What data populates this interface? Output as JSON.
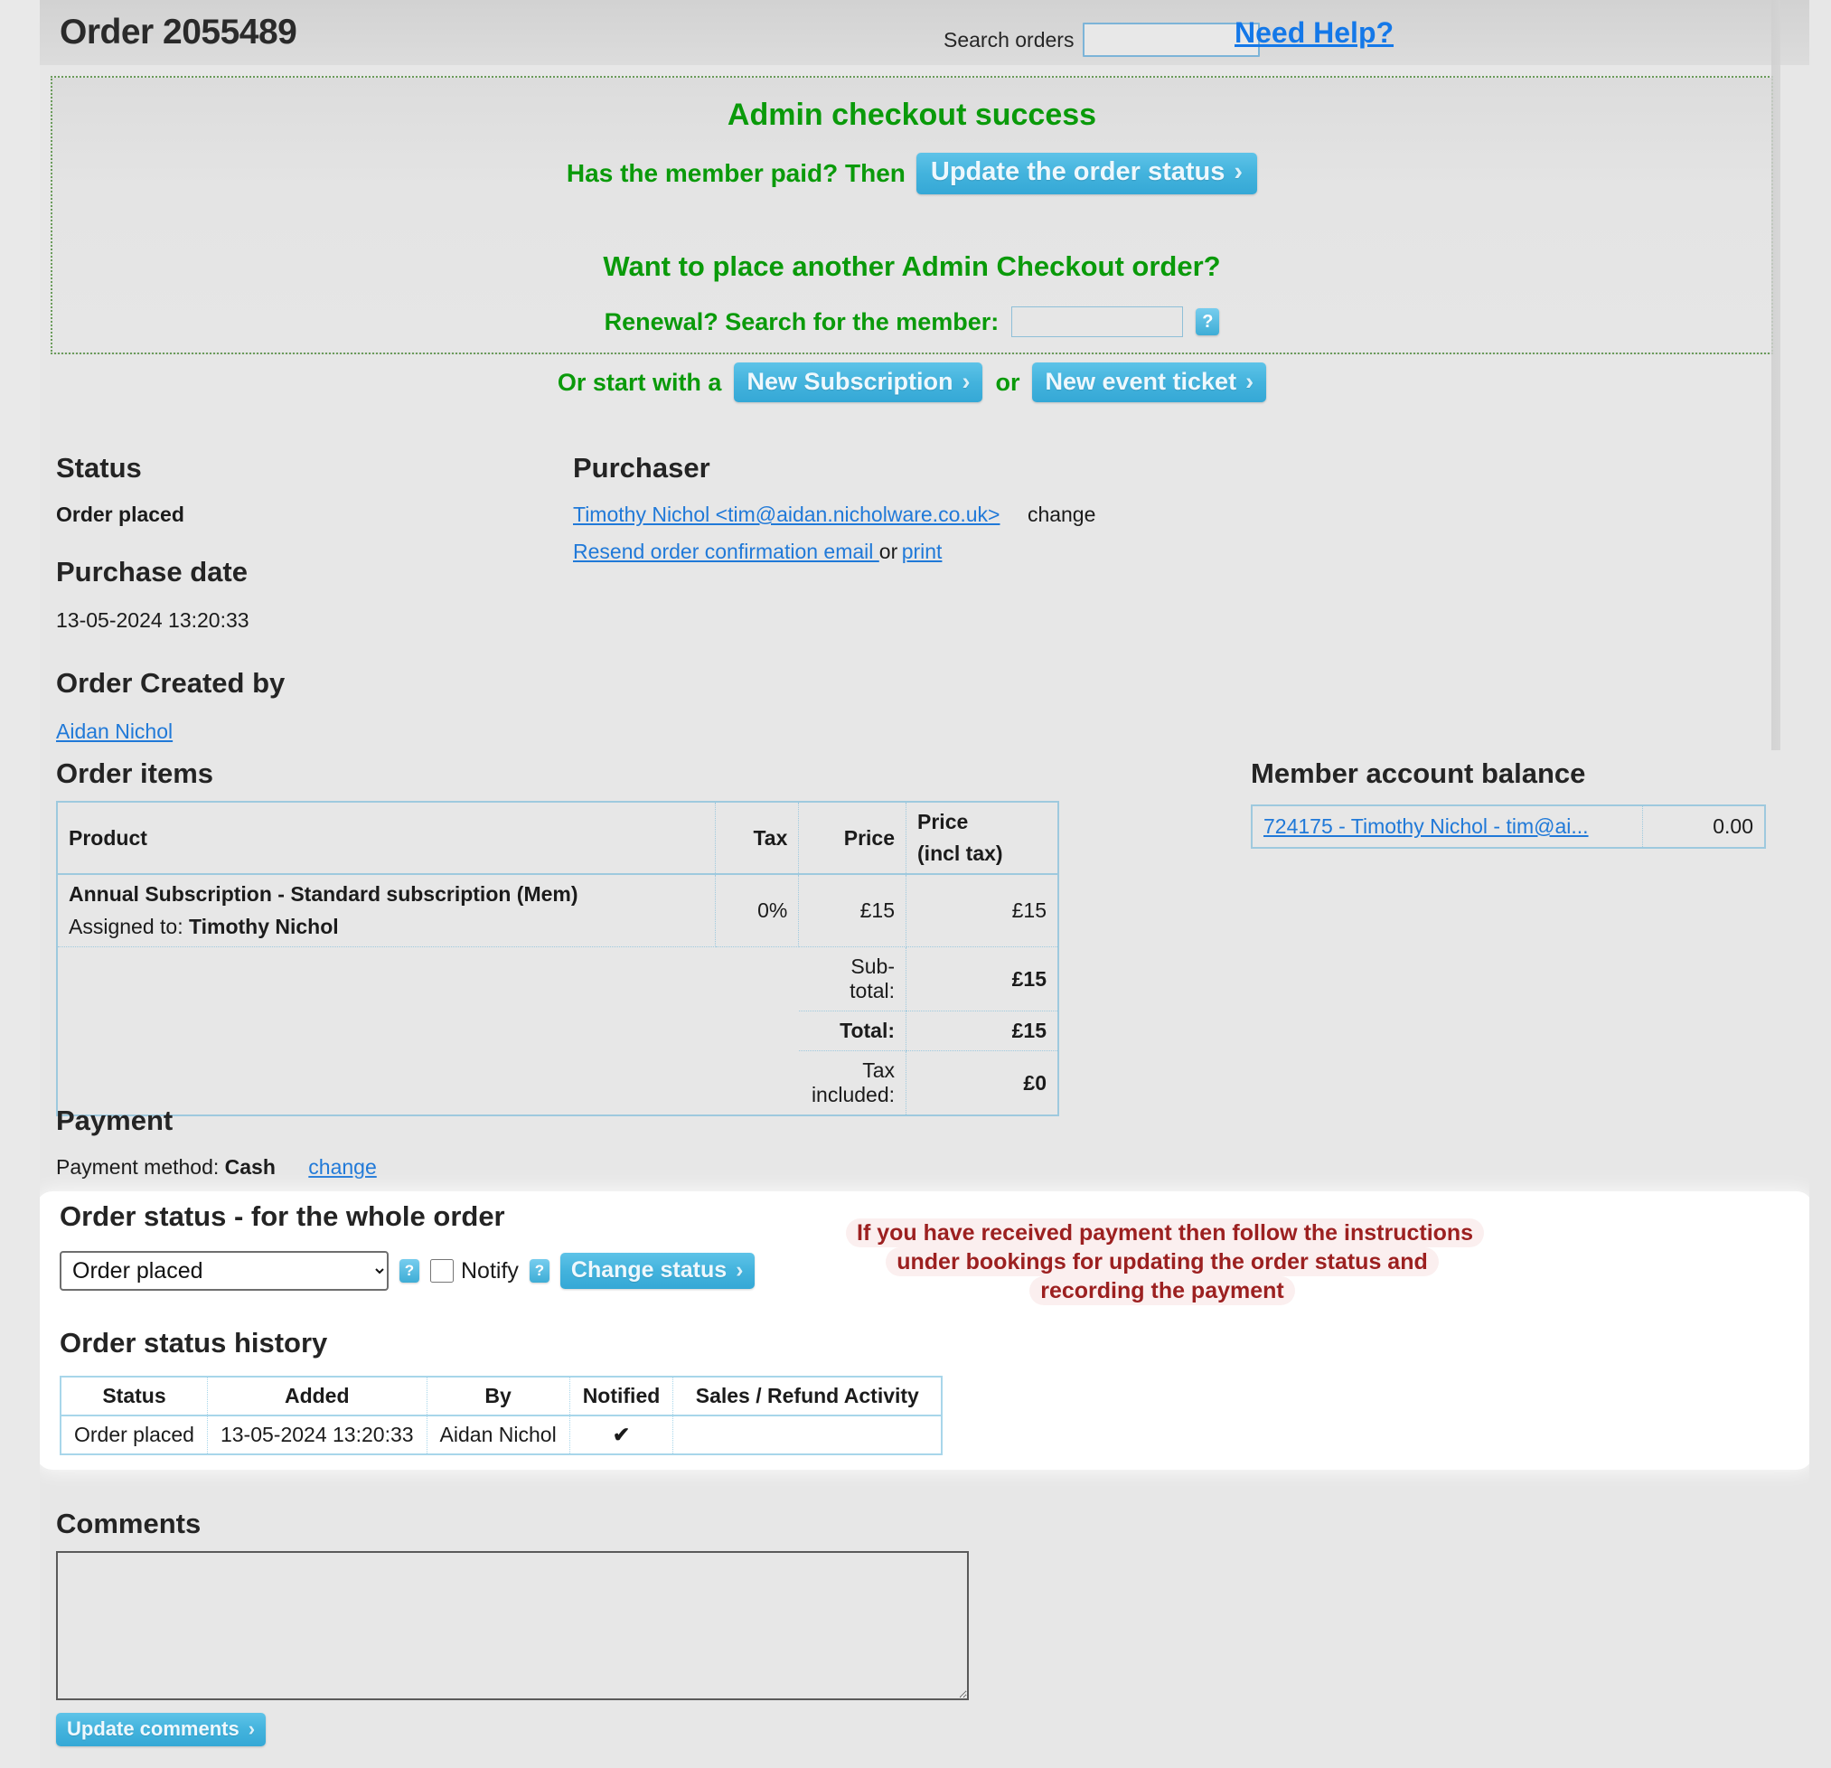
{
  "header": {
    "order_title": "Order 2055489",
    "search_label": "Search orders",
    "search_value": "",
    "search_placeholder": "",
    "need_help": "Need Help?"
  },
  "success_panel": {
    "title": "Admin checkout success",
    "paid_question": "Has the member paid? Then",
    "update_status_button": "Update the order status",
    "another_order_title": "Want to place another Admin Checkout order?",
    "renewal_label": "Renewal? Search for the member:",
    "renewal_value": "",
    "renewal_placeholder": "",
    "help_icon": "?",
    "start_with_label": "Or start with a",
    "new_subscription_button": "New Subscription",
    "or_label": "or",
    "new_event_ticket_button": "New event ticket",
    "chevron": "›"
  },
  "status": {
    "heading": "Status",
    "value": "Order placed",
    "purchase_date_heading": "Purchase date",
    "purchase_date": "13-05-2024 13:20:33",
    "created_by_heading": "Order Created by",
    "created_by": "Aidan Nichol"
  },
  "purchaser": {
    "heading": "Purchaser",
    "name_email": "Timothy Nichol <tim@aidan.nicholware.co.uk>",
    "change": "change",
    "resend_email": "Resend order confirmation email ",
    "or": "or",
    "print": "print"
  },
  "order_items": {
    "heading": "Order items",
    "columns": [
      "Product",
      "Tax",
      "Price",
      "Price",
      "(incl tax)"
    ],
    "col_product": "Product",
    "col_tax": "Tax",
    "col_price": "Price",
    "col_price_incl_1": "Price",
    "col_price_incl_2": "(incl tax)",
    "rows": [
      {
        "product": "Annual Subscription - Standard subscription (Mem)",
        "assigned_label": "Assigned to: ",
        "assigned_to": "Timothy Nichol",
        "tax": "0%",
        "price": "£15",
        "price_incl_tax": "£15"
      }
    ],
    "subtotal_label": "Sub-total:",
    "subtotal_value": "£15",
    "total_label": "Total:",
    "total_value": "£15",
    "tax_included_label": "Tax included:",
    "tax_included_value": "£0"
  },
  "member_balance": {
    "heading": "Member account balance",
    "account_link": "724175 - Timothy Nichol - tim@ai...",
    "balance": "0.00"
  },
  "payment": {
    "heading": "Payment",
    "method_label": "Payment method: ",
    "method": "Cash",
    "change": "change"
  },
  "order_status": {
    "heading": "Order status - for the whole order",
    "selected": "Order placed",
    "options": [
      "Order placed"
    ],
    "help_icon": "?",
    "notify_label": "Notify",
    "notify_checked": false,
    "change_status_button": "Change status",
    "callout": "If you have received payment then follow the instructions under bookings for updating the order status and recording the payment"
  },
  "order_status_history": {
    "heading": "Order status history",
    "columns": [
      "Status",
      "Added",
      "By",
      "Notified",
      "Sales / Refund Activity"
    ],
    "rows": [
      {
        "status": "Order placed",
        "added": "13-05-2024 13:20:33",
        "by": "Aidan Nichol",
        "notified": "✔",
        "activity": ""
      }
    ]
  },
  "comments": {
    "heading": "Comments",
    "value": "",
    "placeholder": "",
    "update_button": "Update comments"
  },
  "colors": {
    "success_green": "#0a9a0a",
    "link_blue": "#2079d8",
    "button_blue": "#43b3dd",
    "callout_red": "#9c2020",
    "table_border": "#9ec9de",
    "page_bg": "#e7e7e7"
  }
}
